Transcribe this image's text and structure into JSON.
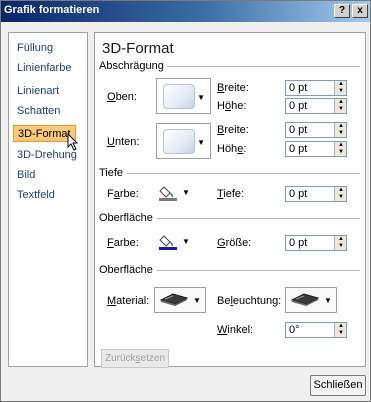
{
  "window": {
    "title": "Grafik formatieren",
    "help_label": "?",
    "close_label": "x"
  },
  "nav": {
    "items": [
      {
        "label": "Füllung"
      },
      {
        "label": "Linienfarbe"
      },
      {
        "label": "Linienart"
      },
      {
        "label": "Schatten"
      },
      {
        "label": "3D-Format"
      },
      {
        "label": "3D-Drehung"
      },
      {
        "label": "Bild"
      },
      {
        "label": "Textfeld"
      }
    ],
    "selected": "3D-Format"
  },
  "main": {
    "heading": "3D-Format",
    "bevel": {
      "group_label": "Abschrägung",
      "top": {
        "label_pre": "",
        "label_u": "O",
        "label_post": "ben:",
        "width": {
          "label_u": "B",
          "label_post": "reite:",
          "value": "0 pt"
        },
        "height": {
          "label_pre": "H",
          "label_u": "ö",
          "label_post": "he:",
          "value": "0 pt"
        }
      },
      "bottom": {
        "label_pre": "",
        "label_u": "U",
        "label_post": "nten:",
        "width": {
          "label_u": "B",
          "label_post": "reite:",
          "value": "0 pt"
        },
        "height": {
          "label_pre": "Höh",
          "label_u": "e",
          "label_post": ":",
          "value": "0 pt"
        }
      }
    },
    "depth": {
      "group_label": "Tiefe",
      "color_label_pre": "F",
      "color_label_u": "a",
      "color_label_post": "rbe:",
      "depth_label_u": "T",
      "depth_label_post": "iefe:",
      "depth_value": "0 pt"
    },
    "contour": {
      "group_label": "Oberfläche",
      "color_label_u": "F",
      "color_label_post": "arbe:",
      "size_label_u": "G",
      "size_label_post": "röße:",
      "size_value": "0 pt"
    },
    "surface": {
      "group_label": "Oberfläche",
      "material_label_u": "M",
      "material_label_post": "aterial:",
      "lighting_label_pre": "Be",
      "lighting_label_u": "l",
      "lighting_label_post": "euchtung:",
      "angle_label_u": "W",
      "angle_label_post": "inkel:",
      "angle_value": "0°"
    },
    "reset": {
      "label_pre": "Zurück",
      "label_u": "s",
      "label_post": "etzen"
    }
  },
  "footer": {
    "close_label": "Schließen"
  },
  "colors": {
    "selected_nav": "#fbc97a",
    "title_start": "#0a246a",
    "title_end": "#a6caf0"
  }
}
